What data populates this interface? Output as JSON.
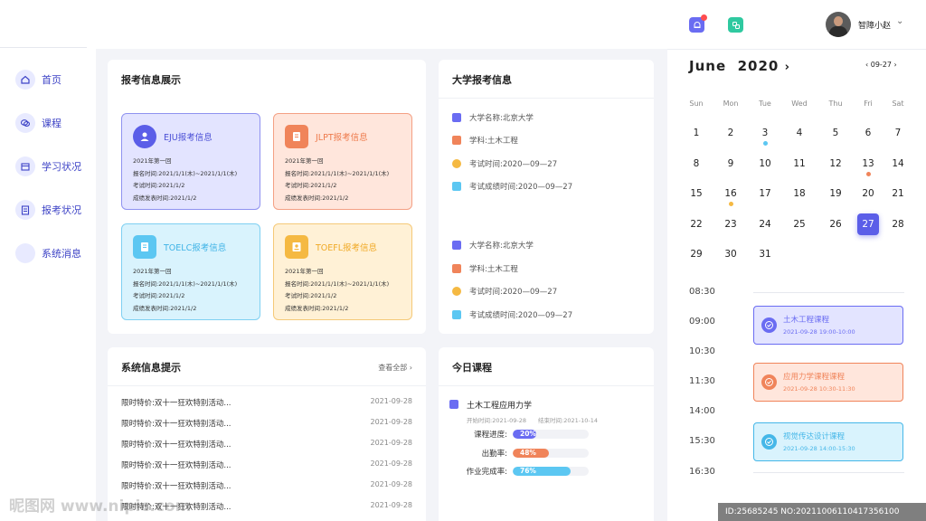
{
  "header": {
    "username": "智障小赵",
    "bell_badge_color": "#ff4d4f"
  },
  "sidebar": {
    "items": [
      {
        "label": "首页",
        "icon": "home-icon"
      },
      {
        "label": "课程",
        "icon": "chat-icon"
      },
      {
        "label": "学习状况",
        "icon": "calendar-icon"
      },
      {
        "label": "报考状况",
        "icon": "clipboard-icon"
      },
      {
        "label": "系统消息",
        "icon": "message-icon"
      }
    ]
  },
  "exam_card": {
    "title": "报考信息展示",
    "tiles": [
      {
        "title": "EJU报考信息",
        "rows": [
          "2021年第一回",
          "报名时间:2021/1/1(木)~2021/1/1(木)",
          "考试时间:2021/1/2",
          "成绩发表时间:2021/1/2"
        ]
      },
      {
        "title": "JLPT报考信息",
        "rows": [
          "2021年第一回",
          "报名时间:2021/1/1(木)~2021/1/1(木)",
          "考试时间:2021/1/2",
          "成绩发表时间:2021/1/2"
        ]
      },
      {
        "title": "TOELC报考信息",
        "rows": [
          "2021年第一回",
          "报名时间:2021/1/1(木)~2021/1/1(木)",
          "考试时间:2021/1/2",
          "成绩发表时间:2021/1/2"
        ]
      },
      {
        "title": "TOEFL报考信息",
        "rows": [
          "2021年第一回",
          "报名时间:2021/1/1(木)~2021/1/1(木)",
          "考试时间:2021/1/2",
          "成绩发表时间:2021/1/2"
        ]
      }
    ]
  },
  "uni_card": {
    "title": "大学报考信息",
    "groups": [
      [
        "大学名称:北京大学",
        "学科:土木工程",
        "考试时间:2020—09—27",
        "考试成绩时间:2020—09—27"
      ],
      [
        "大学名称:北京大学",
        "学科:土木工程",
        "考试时间:2020—09—27",
        "考试成绩时间:2020—09—27"
      ]
    ]
  },
  "notice_card": {
    "title": "系统信息提示",
    "view_all": "查看全部",
    "rows": [
      {
        "text": "限时特价:双十一狂欢特别活动...",
        "date": "2021-09-28"
      },
      {
        "text": "限时特价:双十一狂欢特别活动...",
        "date": "2021-09-28"
      },
      {
        "text": "限时特价:双十一狂欢特别活动...",
        "date": "2021-09-28"
      },
      {
        "text": "限时特价:双十一狂欢特别活动...",
        "date": "2021-09-28"
      },
      {
        "text": "限时特价:双十一狂欢特别活动...",
        "date": "2021-09-28"
      },
      {
        "text": "限时特价:双十一狂欢特别活动...",
        "date": "2021-09-28"
      }
    ]
  },
  "today_card": {
    "title": "今日课程",
    "course": "土木工程应用力学",
    "start": "开始时间:2021-09-28",
    "end": "结束时间:2021-10-14",
    "progress": [
      {
        "label": "课程进度:",
        "value": "20%",
        "fraction": 0.2,
        "color": "#6a6cf2"
      },
      {
        "label": "出勤率:",
        "value": "48%",
        "fraction": 0.48,
        "color": "#f0845a"
      },
      {
        "label": "作业完成率:",
        "value": "76%",
        "fraction": 0.76,
        "color": "#5cc7f2"
      }
    ]
  },
  "calendar": {
    "month": "June",
    "year": "2020",
    "selected_label": "09-27",
    "weekdays": [
      "Sun",
      "Mon",
      "Tue",
      "Wed",
      "Thu",
      "Fri",
      "Sat"
    ],
    "weeks": [
      [
        "1",
        "2",
        "3",
        "4",
        "5",
        "6",
        "7"
      ],
      [
        "8",
        "9",
        "10",
        "11",
        "12",
        "13",
        "14"
      ],
      [
        "15",
        "16",
        "17",
        "18",
        "19",
        "20",
        "21"
      ],
      [
        "22",
        "23",
        "24",
        "25",
        "26",
        "27",
        "28"
      ],
      [
        "29",
        "30",
        "31",
        "",
        "",
        "",
        ""
      ]
    ],
    "selected_day": "27",
    "dots": {
      "3": "#5cc7f2",
      "13": "#f0845a",
      "16": "#f5b942"
    }
  },
  "schedule": {
    "times": [
      "08:30",
      "09:00",
      "10:30",
      "11:30",
      "14:00",
      "15:30",
      "16:30"
    ],
    "events": [
      {
        "title": "土木工程课程",
        "time": "2021-09-28   19:00-10:00",
        "color": "#6a6cf2",
        "bg": "#e3e4ff"
      },
      {
        "title": "应用力学课程课程",
        "time": "2021-09-28   10:30-11:30",
        "color": "#f0845a",
        "bg": "#ffe6dc"
      },
      {
        "title": "视觉传达设计课程",
        "time": "2021-09-28   14:00-15:30",
        "color": "#45b7e8",
        "bg": "#d9f3fd"
      }
    ]
  },
  "watermark": "昵图网 www.nipic.com",
  "idbar": "ID:25685245 NO:20211006110417356100"
}
